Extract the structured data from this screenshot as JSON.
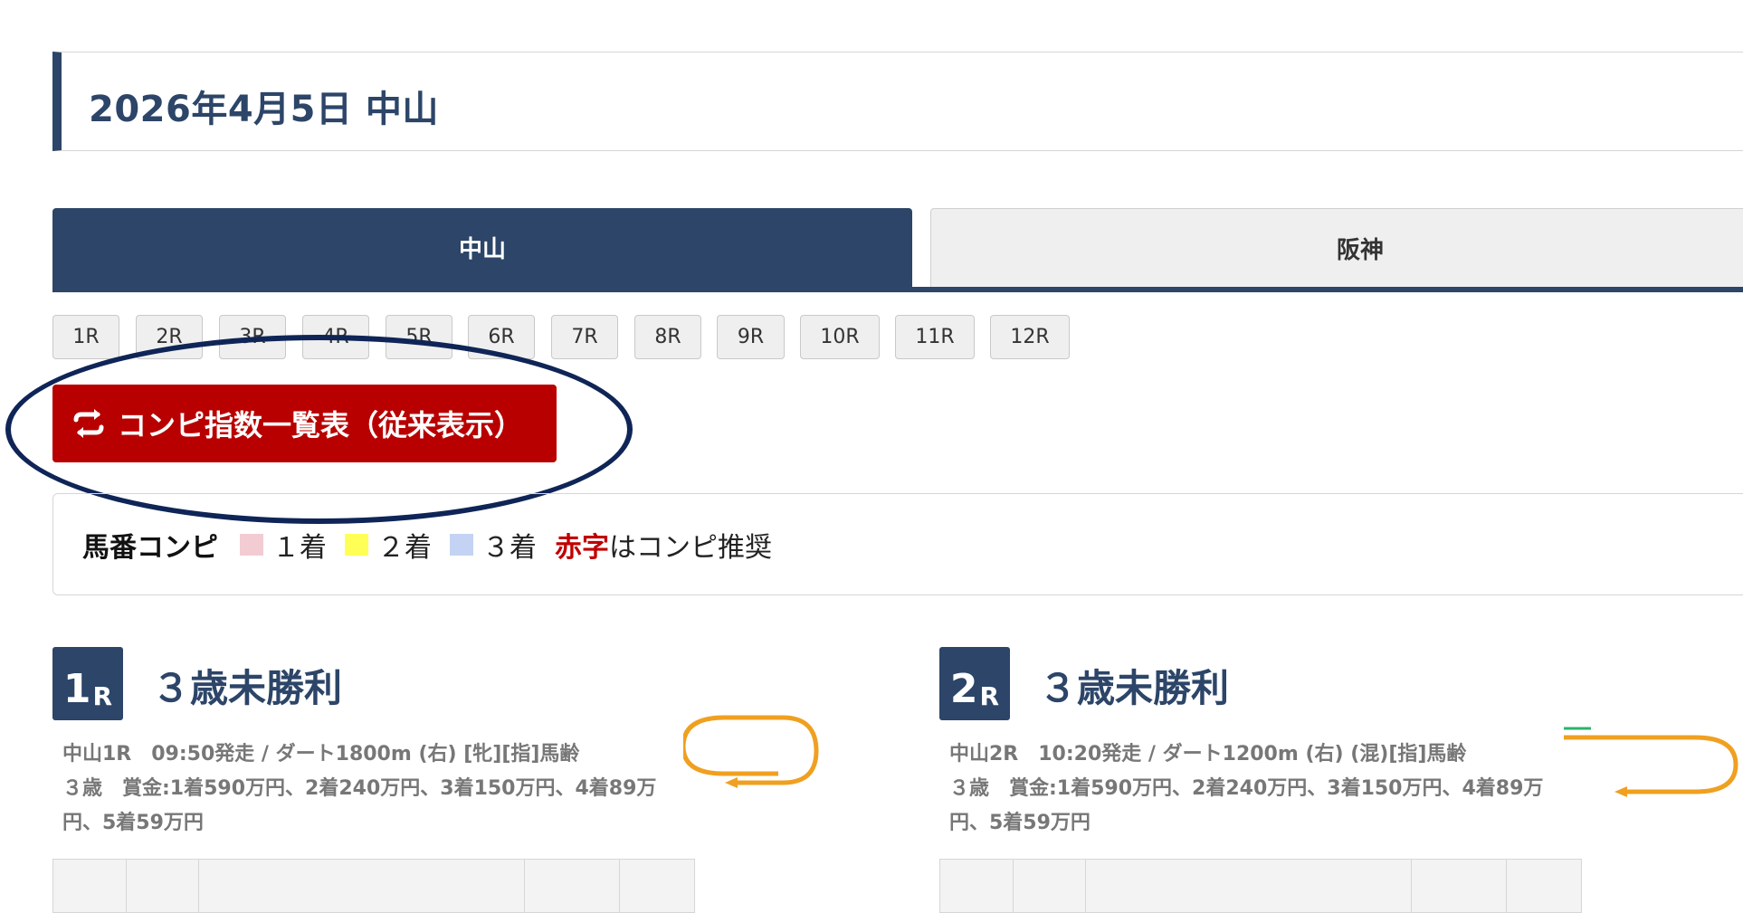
{
  "header": {
    "title": "2026年4月5日 中山"
  },
  "venue_tabs": [
    {
      "label": "中山",
      "active": true
    },
    {
      "label": "阪神",
      "active": false
    }
  ],
  "race_buttons": [
    "1R",
    "2R",
    "3R",
    "4R",
    "5R",
    "6R",
    "7R",
    "8R",
    "9R",
    "10R",
    "11R",
    "12R"
  ],
  "compi_button": {
    "label": "コンピ指数一覧表（従来表示）",
    "icon": "swap-arrows-icon"
  },
  "legend": {
    "title": "馬番コンピ",
    "items": [
      {
        "label": "１着",
        "color": "#f2ccd2"
      },
      {
        "label": "２着",
        "color": "#ffff55"
      },
      {
        "label": "３着",
        "color": "#c4d3f3"
      }
    ],
    "red_word": "赤字",
    "suffix": "はコンピ推奨"
  },
  "races": [
    {
      "number": "1",
      "suffix": "R",
      "title": "３歳未勝利",
      "meta_line1": "中山1R　09:50発走 / ダート1800m (右) [牝][指]馬齢",
      "meta_line2": "３歳　賞金:1着590万円、2着240万円、3着150万円、4着89万",
      "meta_line3": "円、5着59万円",
      "course_icon": "course-loop-icon"
    },
    {
      "number": "2",
      "suffix": "R",
      "title": "３歳未勝利",
      "meta_line1": "中山2R　10:20発走 / ダート1200m (右) (混)[指]馬齢",
      "meta_line2": "３歳　賞金:1着590万円、2着240万円、3着150万円、4着89万",
      "meta_line3": "円、5着59万円",
      "course_icon": "course-loop-icon"
    }
  ],
  "colors": {
    "navy": "#2c4568",
    "red_button": "#b80000",
    "ellipse": "#0f2557",
    "course_orange": "#f0a020",
    "course_green": "#2ab36a"
  }
}
